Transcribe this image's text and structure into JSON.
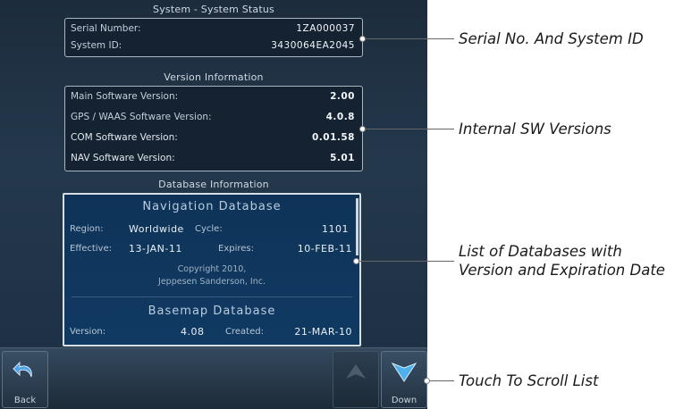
{
  "system": {
    "title": "System - System Status",
    "serial_label": "Serial Number:",
    "serial_value": "1ZA000037",
    "sysid_label": "System ID:",
    "sysid_value": "3430064EA2045"
  },
  "version": {
    "title": "Version Information",
    "rows": [
      {
        "label": "Main Software Version:",
        "value": "2.00"
      },
      {
        "label": "GPS / WAAS Software Version:",
        "value": "4.0.8"
      },
      {
        "label": "COM Software Version:",
        "value": "0.01.58"
      },
      {
        "label": "NAV Software Version:",
        "value": "5.01"
      }
    ]
  },
  "database": {
    "title": "Database Information",
    "nav": {
      "title": "Navigation Database",
      "region_label": "Region:",
      "region_value": "Worldwide",
      "cycle_label": "Cycle:",
      "cycle_value": "1101",
      "effective_label": "Effective:",
      "effective_value": "13-JAN-11",
      "expires_label": "Expires:",
      "expires_value": "10-FEB-11",
      "copyright_line1": "Copyright 2010,",
      "copyright_line2": "Jeppesen Sanderson, Inc."
    },
    "basemap": {
      "title": "Basemap Database",
      "version_label": "Version:",
      "version_value": "4.08",
      "created_label": "Created:",
      "created_value": "21-MAR-10"
    }
  },
  "buttons": {
    "back": "Back",
    "down": "Down"
  },
  "callouts": {
    "serial": "Serial No. And System ID",
    "versions": "Internal SW Versions",
    "databases_line1": "List of Databases with",
    "databases_line2": "Version and Expiration Date",
    "scroll": "Touch To Scroll List"
  }
}
